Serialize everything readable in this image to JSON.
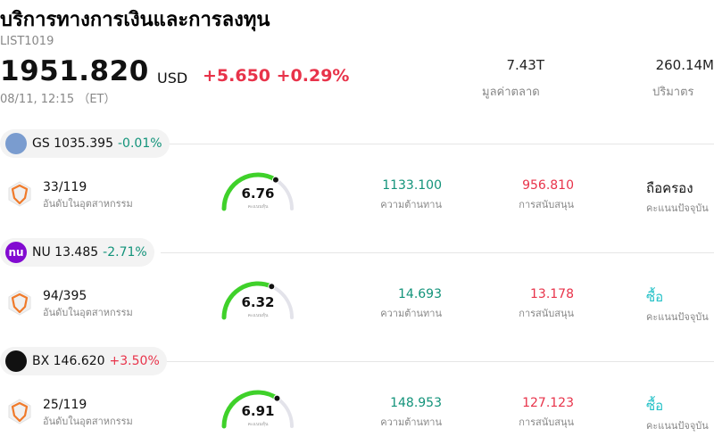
{
  "header": {
    "title": "บริการทางการเงินและการลงทุน",
    "code": "LIST1019",
    "price": "1951.820",
    "currency": "USD",
    "change": "+5.650 +0.29%",
    "time": "08/11, 12:15 （ET）",
    "market_cap_value": "7.43T",
    "market_cap_label": "มูลค่าตลาด",
    "volume_value": "260.14M",
    "volume_label": "ปริมาตร"
  },
  "stocks": [
    {
      "ticker": "GS 1035.395",
      "pct": "-0.01%",
      "pct_color": "#12937a",
      "logo_color": "#7a9ccf",
      "logo_text": "",
      "rank": "33/119",
      "rank_label": "อันดับในอุตสาหกรรม",
      "score": "6.76",
      "score_fraction": 0.676,
      "score_label": "คะแนนหุ้น",
      "resistance": "1133.100",
      "resistance_label": "ความต้านทาน",
      "support": "956.810",
      "support_label": "การสนับสนุน",
      "rating": "ถือครอง",
      "rating_color": "#111111",
      "rating_label": "คะแนนปัจจุบัน"
    },
    {
      "ticker": "NU 13.485",
      "pct": "-2.71%",
      "pct_color": "#12937a",
      "logo_color": "#820ad1",
      "logo_text": "nu",
      "rank": "94/395",
      "rank_label": "อันดับในอุตสาหกรรม",
      "score": "6.32",
      "score_fraction": 0.632,
      "score_label": "คะแนนหุ้น",
      "resistance": "14.693",
      "resistance_label": "ความต้านทาน",
      "support": "13.178",
      "support_label": "การสนับสนุน",
      "rating": "ซื้อ",
      "rating_color": "#21c0c6",
      "rating_label": "คะแนนปัจจุบัน"
    },
    {
      "ticker": "BX 146.620",
      "pct": "+3.50%",
      "pct_color": "#e8334a",
      "logo_color": "#111111",
      "logo_text": "",
      "rank": "25/119",
      "rank_label": "อันดับในอุตสาหกรรม",
      "score": "6.91",
      "score_fraction": 0.691,
      "score_label": "คะแนนหุ้น",
      "resistance": "148.953",
      "resistance_label": "ความต้านทาน",
      "support": "127.123",
      "support_label": "การสนับสนุน",
      "rating": "ซื้อ",
      "rating_color": "#21c0c6",
      "rating_label": "คะแนนปัจจุบัน"
    }
  ]
}
